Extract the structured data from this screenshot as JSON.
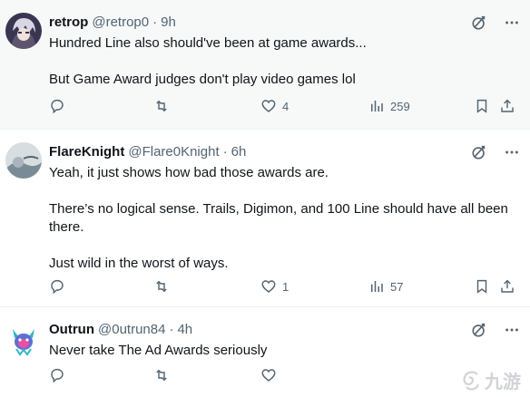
{
  "tweets": [
    {
      "display_name": "retrop",
      "handle": "@retrop0",
      "dot": "·",
      "time": "9h",
      "paragraphs": [
        "Hundred Line also should've been at game awards...",
        "But Game Award judges don't play video games lol"
      ],
      "likes": "4",
      "views": "259"
    },
    {
      "display_name": "FlareKnight",
      "handle": "@Flare0Knight",
      "dot": "·",
      "time": "6h",
      "paragraphs": [
        "Yeah, it just shows how bad those awards are.",
        "There’s no logical sense. Trails, Digimon, and 100 Line should have all been there.",
        "Just wild in the worst of ways."
      ],
      "likes": "1",
      "views": "57"
    },
    {
      "display_name": "Outrun",
      "handle": "@0utrun84",
      "dot": "·",
      "time": "4h",
      "paragraphs": [
        "Never take The Ad Awards seriously"
      ]
    }
  ],
  "icons": {
    "grok": "grok-icon",
    "more": "more-icon",
    "reply": "reply-icon",
    "retweet": "retweet-icon",
    "like": "heart-icon",
    "views": "views-icon",
    "bookmark": "bookmark-icon",
    "share": "share-icon"
  },
  "watermark": {
    "text": "九游"
  },
  "colors": {
    "text": "#0f1419",
    "muted": "#536471",
    "highlight_bg": "#f7f9f9",
    "divider": "#eff3f4"
  }
}
